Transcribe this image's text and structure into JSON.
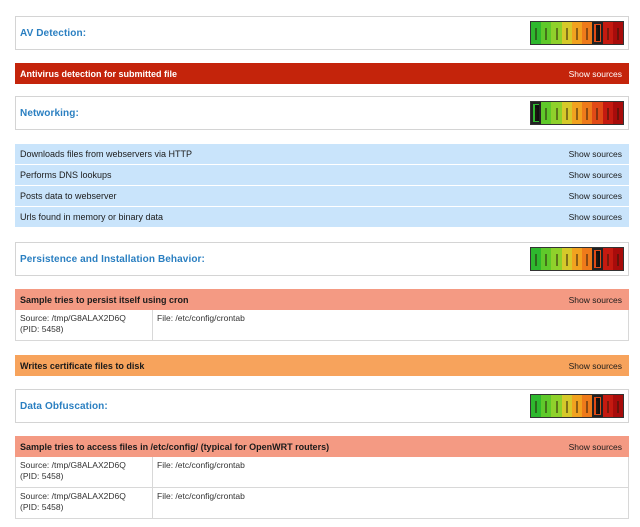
{
  "colors": {
    "title": "#2a7fc1",
    "red": "#c4240b",
    "blue": "#c9e4fb",
    "salmon": "#f49a83",
    "orange": "#f7a35c"
  },
  "meter_gradient": [
    "#2eb82e",
    "#5fc92a",
    "#8fd12b",
    "#d6c92a",
    "#f1a21f",
    "#ee7a1a",
    "#e14a16",
    "#c51a10",
    "#a80c0b"
  ],
  "sections": {
    "av": {
      "title": "AV Detection:",
      "level": 6
    },
    "net": {
      "title": "Networking:",
      "level": 0
    },
    "persist": {
      "title": "Persistence and Installation Behavior:",
      "level": 6
    },
    "obf": {
      "title": "Data Obfuscation:",
      "level": 6
    }
  },
  "signatures": {
    "av_1": {
      "label": "Antivirus detection for submitted file",
      "link": "Show sources"
    },
    "net_1": {
      "label": "Downloads files from webservers via HTTP",
      "link": "Show sources"
    },
    "net_2": {
      "label": "Performs DNS lookups",
      "link": "Show sources"
    },
    "net_3": {
      "label": "Posts data to webserver",
      "link": "Show sources"
    },
    "net_4": {
      "label": "Urls found in memory or binary data",
      "link": "Show sources"
    },
    "persist_1": {
      "label": "Sample tries to persist itself using cron",
      "link": "Show sources"
    },
    "persist_2": {
      "label": "Writes certificate files to disk",
      "link": "Show sources"
    },
    "obf_1": {
      "label": "Sample tries to access files in /etc/config/ (typical for OpenWRT routers)",
      "link": "Show sources"
    }
  },
  "details": {
    "persist_1_a": {
      "source": "Source: /tmp/G8ALAX2D6Q",
      "pid": "(PID: 5458)",
      "file": "File: /etc/config/crontab"
    },
    "obf_1_a": {
      "source": "Source: /tmp/G8ALAX2D6Q",
      "pid": "(PID: 5458)",
      "file": "File: /etc/config/crontab"
    },
    "obf_1_b": {
      "source": "Source: /tmp/G8ALAX2D6Q",
      "pid": "(PID: 5458)",
      "file": "File: /etc/config/crontab"
    }
  }
}
